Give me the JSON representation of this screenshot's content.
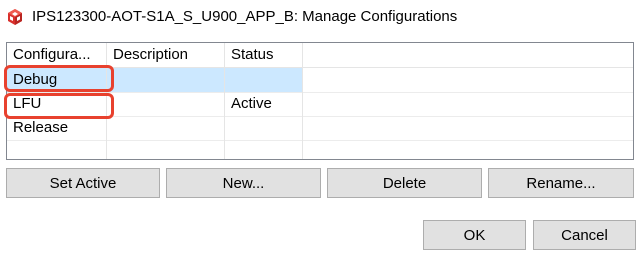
{
  "window": {
    "title": "IPS123300-AOT-S1A_S_U900_APP_B: Manage Configurations",
    "icon": "red-cube-icon"
  },
  "table": {
    "columns": [
      "Configura...",
      "Description",
      "Status"
    ],
    "rows": [
      {
        "name": "Debug",
        "description": "",
        "status": "",
        "selected": true
      },
      {
        "name": "LFU",
        "description": "",
        "status": "Active",
        "selected": false
      },
      {
        "name": "Release",
        "description": "",
        "status": "",
        "selected": false
      }
    ]
  },
  "actions": {
    "set_active": "Set Active",
    "new": "New...",
    "delete": "Delete",
    "rename": "Rename..."
  },
  "dialog": {
    "ok": "OK",
    "cancel": "Cancel"
  },
  "colors": {
    "selection": "#cce8ff",
    "highlight": "#e8412e",
    "icon": "#d9302c"
  }
}
